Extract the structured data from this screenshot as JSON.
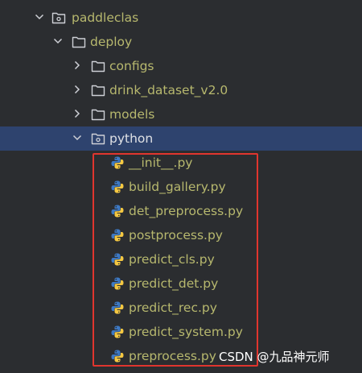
{
  "colors": {
    "background": "#2b2d30",
    "text": "#b7b86e",
    "selected_row": "#2e436e",
    "selected_text": "#dfe1e5",
    "highlight_box": "#e0352e",
    "folder_icon": "#ced0d6"
  },
  "tree": {
    "root": {
      "label": "paddleclas",
      "icon": "package-folder-icon",
      "expanded": true
    },
    "deploy": {
      "label": "deploy",
      "icon": "folder-icon",
      "expanded": true
    },
    "configs": {
      "label": "configs",
      "icon": "folder-icon",
      "expanded": false
    },
    "drink_dataset": {
      "label": "drink_dataset_v2.0",
      "icon": "folder-icon",
      "expanded": false
    },
    "models": {
      "label": "models",
      "icon": "folder-icon",
      "expanded": false
    },
    "python": {
      "label": "python",
      "icon": "package-folder-icon",
      "expanded": true,
      "selected": true
    },
    "files": [
      {
        "label": "__init__.py",
        "icon": "python-file-icon"
      },
      {
        "label": "build_gallery.py",
        "icon": "python-file-icon"
      },
      {
        "label": "det_preprocess.py",
        "icon": "python-file-icon"
      },
      {
        "label": "postprocess.py",
        "icon": "python-file-icon"
      },
      {
        "label": "predict_cls.py",
        "icon": "python-file-icon"
      },
      {
        "label": "predict_det.py",
        "icon": "python-file-icon"
      },
      {
        "label": "predict_rec.py",
        "icon": "python-file-icon"
      },
      {
        "label": "predict_system.py",
        "icon": "python-file-icon"
      },
      {
        "label": "preprocess.py",
        "icon": "python-file-icon"
      }
    ]
  },
  "watermark": "CSDN @九品神元师"
}
